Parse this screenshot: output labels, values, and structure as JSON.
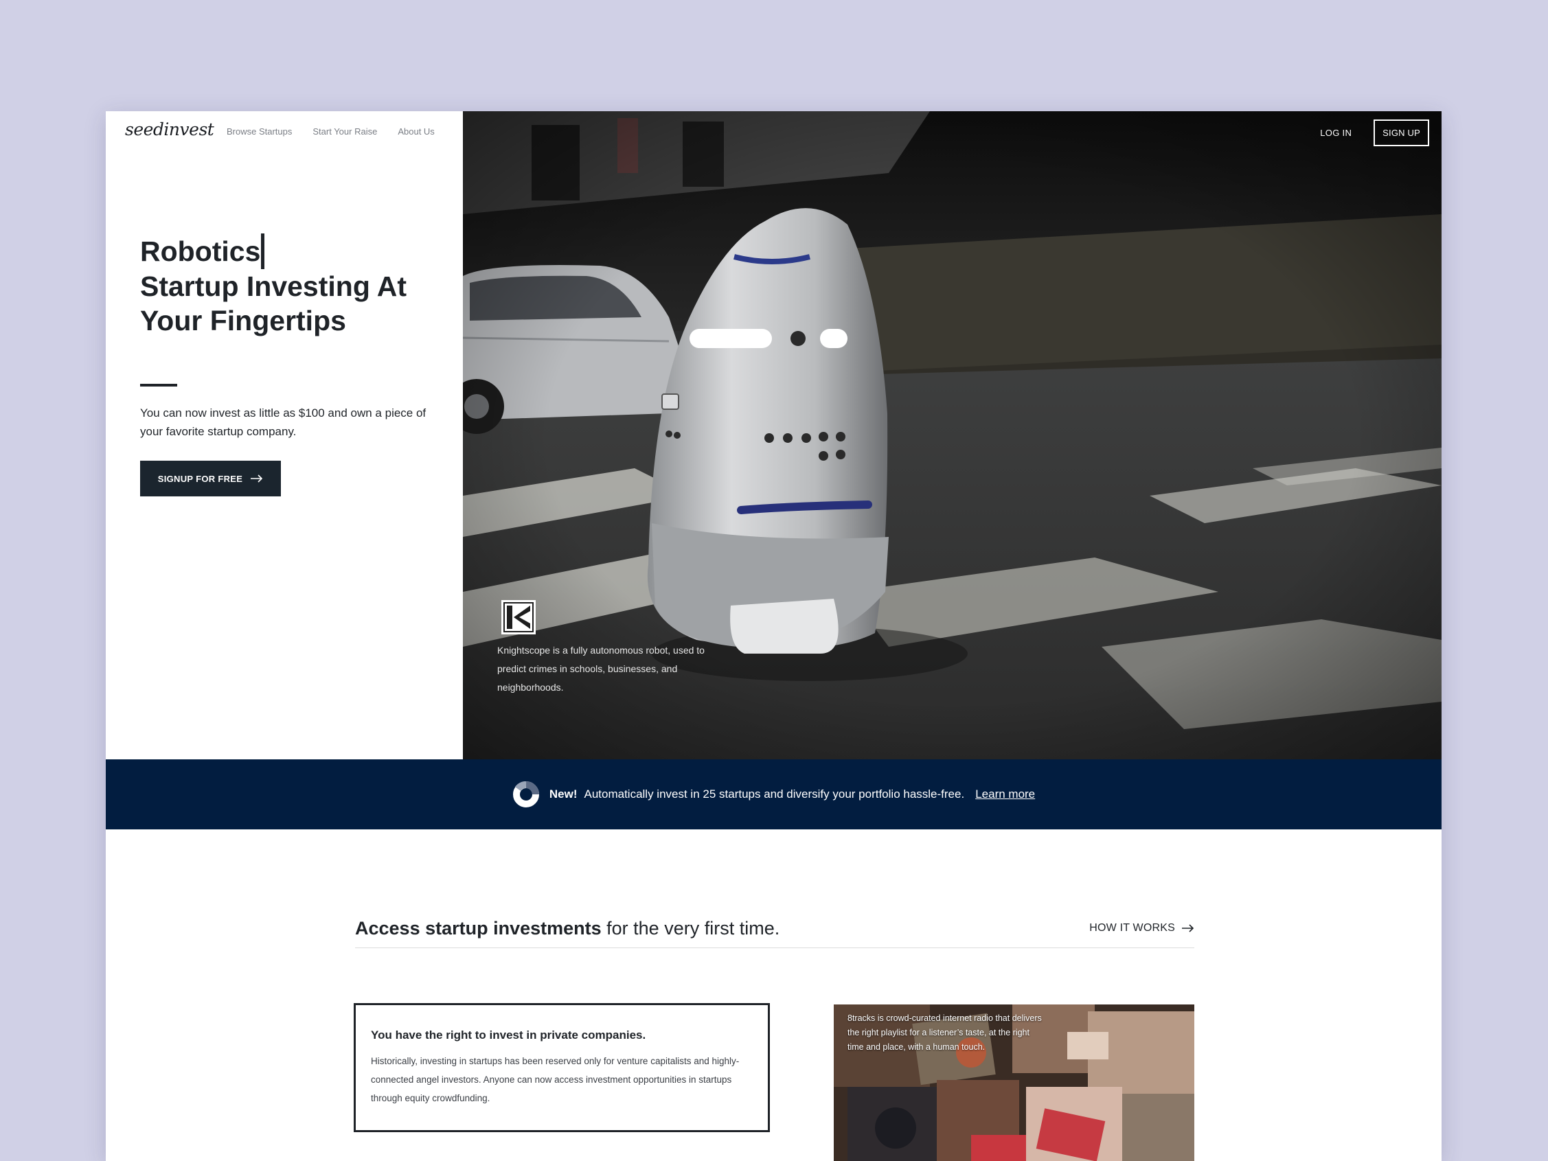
{
  "brand": {
    "logo_text": "seedinvest"
  },
  "nav": {
    "items": [
      {
        "label": "Browse Startups"
      },
      {
        "label": "Start Your Raise"
      },
      {
        "label": "About Us"
      }
    ]
  },
  "auth": {
    "login_label": "LOG IN",
    "signup_label": "SIGN UP"
  },
  "hero": {
    "title_line1": "Robotics",
    "title_line2": "Startup Investing At",
    "title_line3": "Your Fingertips",
    "description": "You can now invest as little as $100 and own a piece of your favorite startup company.",
    "cta_label": "SIGNUP FOR FREE",
    "image_caption": "Knightscope is a fully autonomous robot, used to predict crimes in schools, businesses, and neighborhoods."
  },
  "banner": {
    "new_label": "New!",
    "message": "Automatically invest in 25 startups and diversify your portfolio hassle-free.",
    "link_label": "Learn more",
    "background_color": "#021d40"
  },
  "access": {
    "title_bold": "Access startup investments",
    "title_rest": " for the very first time.",
    "how_it_works_label": "HOW IT WORKS"
  },
  "cards": {
    "rights_title": "You have the right to invest in private companies.",
    "rights_body": "Historically, investing in startups has been reserved only for venture capitalists and highly-connected angel investors. Anyone can now access investment opportunities in startups through equity crowdfunding.",
    "media_caption": "8tracks is crowd-curated internet radio that delivers the right playlist for a listener’s taste, at the right time and place, with a human touch."
  },
  "colors": {
    "page_background": "#d0d0e6",
    "dark_text": "#1f2328",
    "cta_background": "#1b252e"
  },
  "icons": {
    "arrow": "arrow-right-icon",
    "knightscope": "knightscope-logo-icon",
    "donut": "portfolio-donut-icon"
  }
}
